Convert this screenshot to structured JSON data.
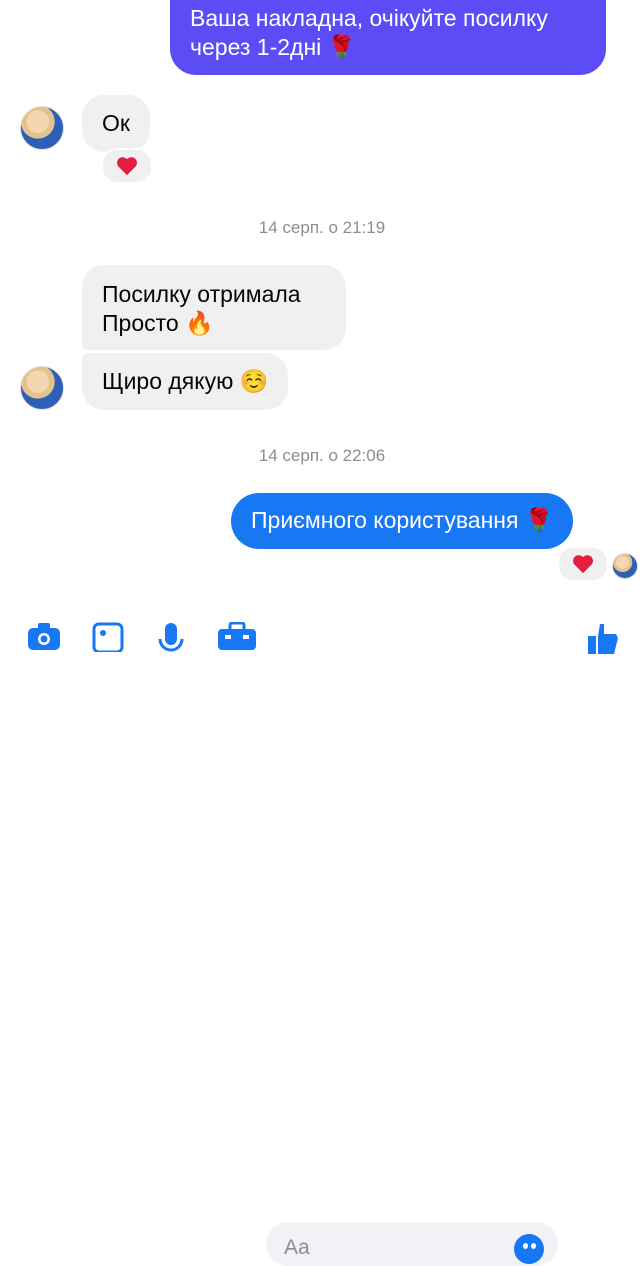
{
  "messages": {
    "outgoing_top": {
      "line1": "Ваша накладна, очікуйте посилку",
      "line2": "через 1-2дні",
      "emoji": "🌹"
    },
    "incoming_ok": {
      "text": "Ок"
    },
    "timestamp_1": "14 серп. о 21:19",
    "incoming_parcel": {
      "line1": "Посилку отримала",
      "line2": "Просто",
      "emoji": "🔥"
    },
    "incoming_thanks": {
      "text": "Щиро дякую",
      "emoji": "☺️"
    },
    "timestamp_2": "14 серп. о 22:06",
    "outgoing_bottom": {
      "text": "Приємного користування",
      "emoji": "🌹"
    }
  },
  "reactions": {
    "ok": "heart",
    "outgoing_bottom": "heart"
  },
  "composer": {
    "placeholder": "Aa"
  },
  "toolbar": {
    "icons": [
      "camera-icon",
      "image-icon",
      "microphone-icon",
      "toolbox-icon",
      "emoji-icon",
      "like-icon"
    ]
  },
  "colors": {
    "outgoing_top": "#5b4cf5",
    "outgoing_bottom": "#1877f2",
    "incoming": "#f0f0f0",
    "heart": "#e41e3f"
  }
}
